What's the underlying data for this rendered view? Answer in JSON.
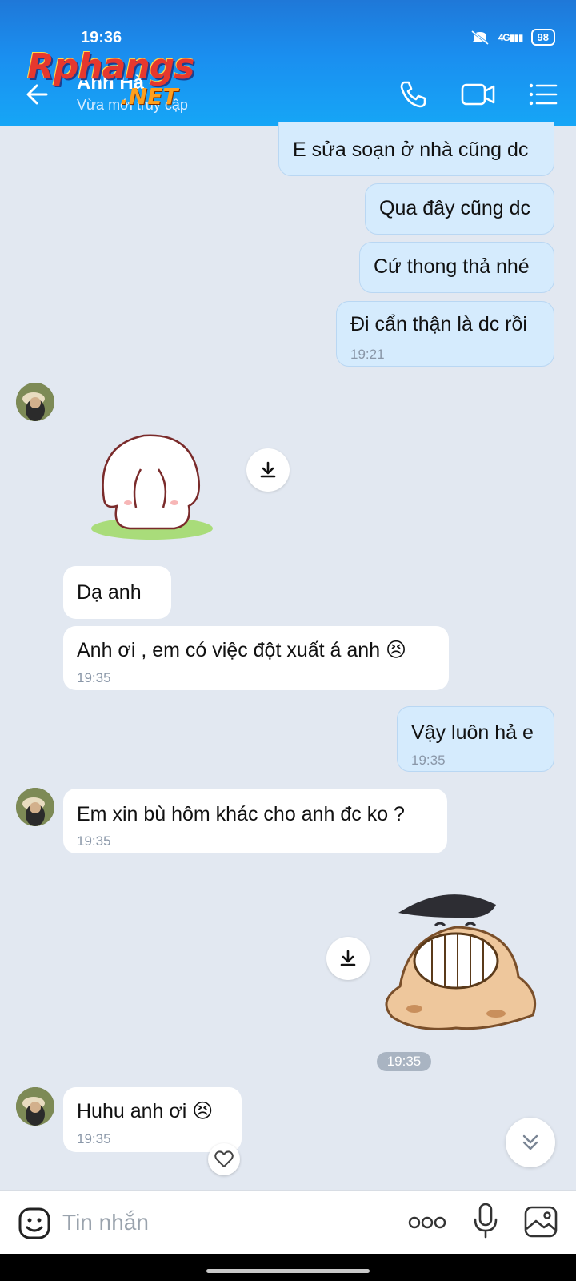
{
  "status_bar": {
    "time": "19:36",
    "network": "4G",
    "battery": "98"
  },
  "header": {
    "contact_name": "Anh Hà",
    "contact_status": "Vừa mới truy cập",
    "watermark_main": "Rphangs",
    "watermark_suffix": ".NET"
  },
  "messages": {
    "m1": {
      "text": "E sửa soạn ở nhà cũng dc"
    },
    "m2": {
      "text": "Qua đây cũng dc"
    },
    "m3": {
      "text": "Cứ thong thả nhé"
    },
    "m4": {
      "text": "Đi cẩn thận là dc rồi",
      "time": "19:21"
    },
    "m5": {
      "text": "Dạ anh"
    },
    "m6": {
      "text": "Anh ơi , em có việc đột xuất á anh 😣",
      "time": "19:35"
    },
    "m7": {
      "text": "Vậy luôn hả e",
      "time": "19:35"
    },
    "m8": {
      "text": "Em xin bù hôm khác cho anh đc ko ?",
      "time": "19:35"
    },
    "sticker_time": "19:35",
    "m9": {
      "text": "Huhu anh ơi 😣",
      "time": "19:35"
    }
  },
  "composer": {
    "placeholder": "Tin nhắn"
  },
  "icons": {
    "back": "arrow-left-icon",
    "call": "phone-icon",
    "video": "video-icon",
    "menu": "list-icon",
    "download": "download-icon",
    "heart": "heart-icon",
    "scroll": "chevrons-down-icon",
    "emoji": "sticker-icon",
    "more": "more-dots-icon",
    "mic": "microphone-icon",
    "gallery": "image-icon"
  },
  "colors": {
    "header": "#1a8ff0",
    "outgoing_bubble": "#d5ebfd",
    "incoming_bubble": "#ffffff",
    "background": "#e2e8f1"
  }
}
